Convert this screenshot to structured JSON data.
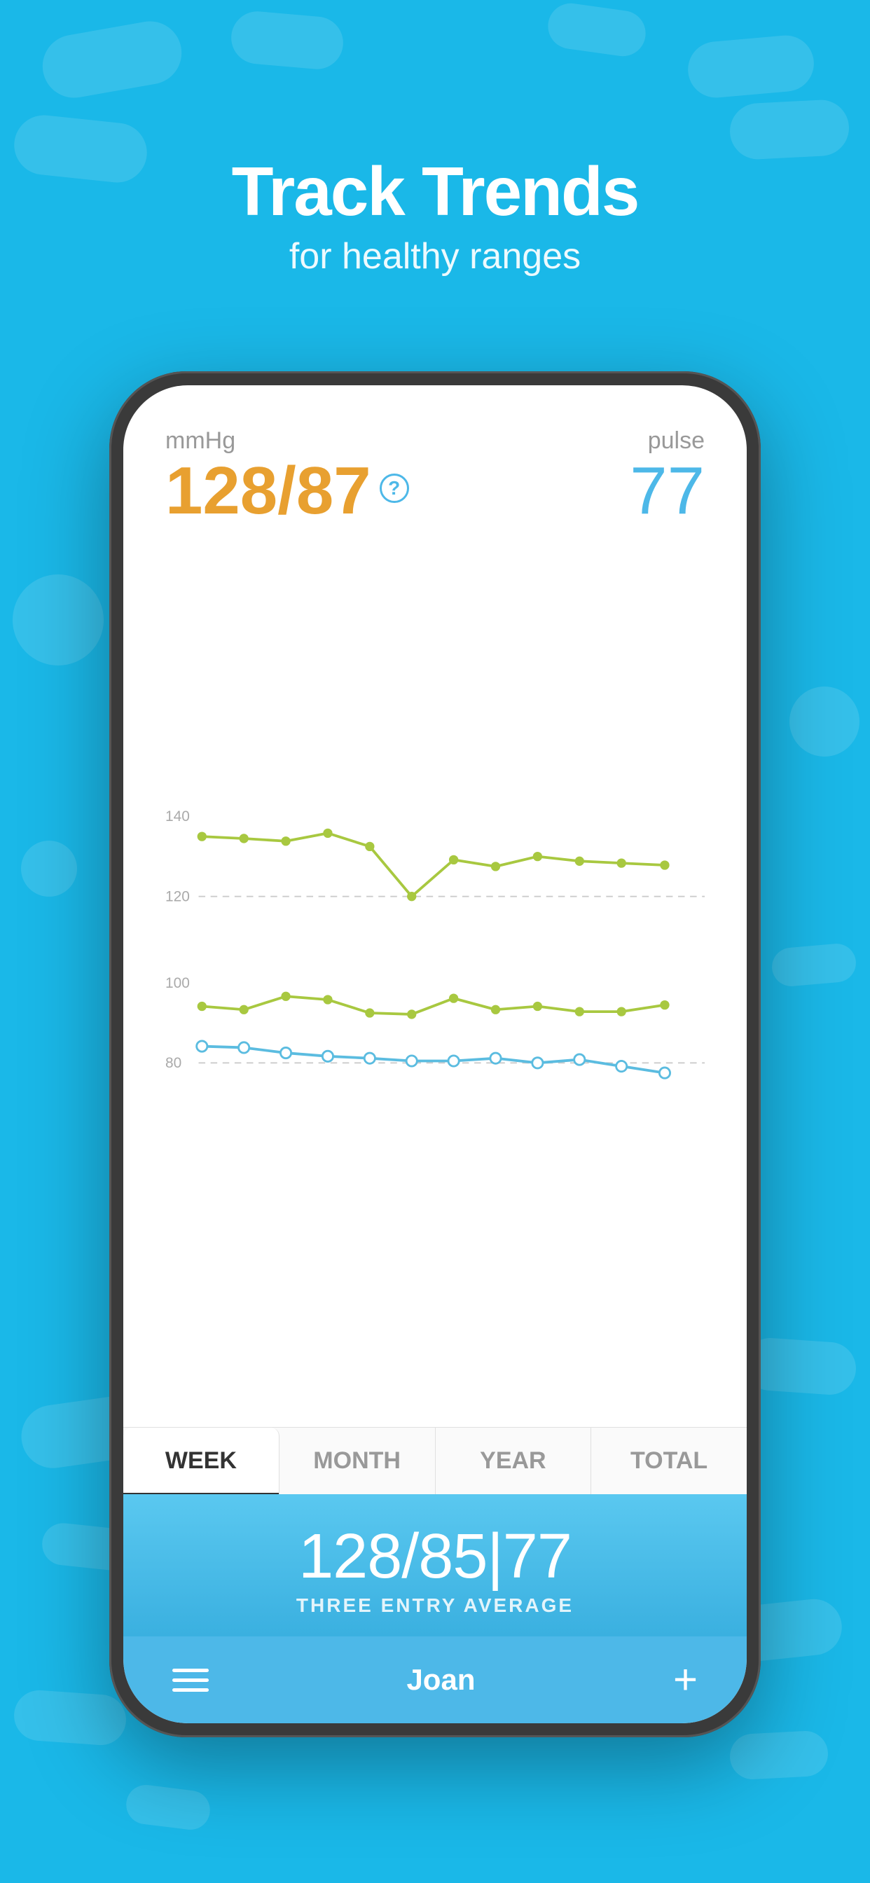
{
  "background": {
    "color": "#1ab8e8"
  },
  "header": {
    "title": "Track Trends",
    "subtitle": "for healthy ranges"
  },
  "phone": {
    "stats": {
      "mmhg_label": "mmHg",
      "bp_value": "128/87",
      "help_icon": "?",
      "pulse_label": "pulse",
      "pulse_value": "77"
    },
    "chart": {
      "y_labels": [
        "140",
        "120",
        "100",
        "80"
      ],
      "dashed_lines": [
        120,
        80
      ],
      "green_upper_points": [
        132,
        131,
        130,
        133,
        128,
        122,
        127,
        125,
        128,
        130,
        127,
        128
      ],
      "green_lower_points": [
        90,
        88,
        91,
        95,
        90,
        88,
        90,
        87,
        88,
        89,
        88,
        90
      ],
      "blue_points": [
        82,
        81,
        80,
        79,
        80,
        81,
        80,
        80,
        79,
        80,
        78,
        77
      ]
    },
    "tabs": [
      {
        "label": "WEEK",
        "active": true
      },
      {
        "label": "MONTH",
        "active": false
      },
      {
        "label": "YEAR",
        "active": false
      },
      {
        "label": "TOTAL",
        "active": false
      }
    ],
    "average": {
      "value": "128/85|77",
      "label": "THREE ENTRY AVERAGE"
    },
    "nav": {
      "menu_icon": "menu",
      "name": "Joan",
      "plus": "+"
    }
  }
}
